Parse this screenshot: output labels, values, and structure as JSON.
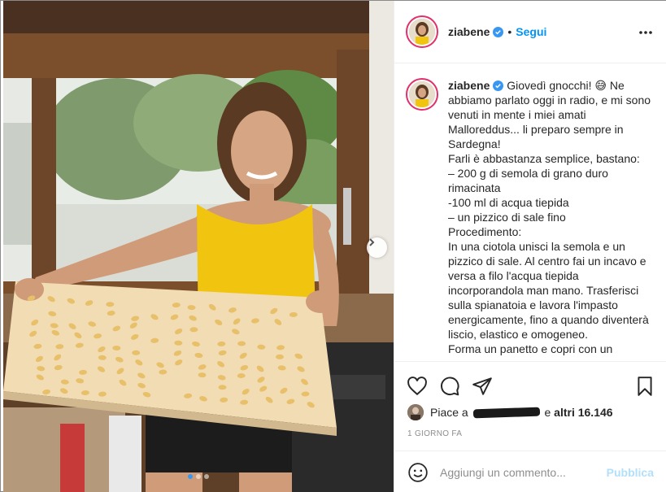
{
  "post": {
    "username": "ziabene",
    "follow_label": "Segui",
    "separator": "•",
    "caption_user": "ziabene",
    "caption_text": " Giovedì gnocchi! 😅 Ne abbiamo parlato oggi in radio, e mi sono venuti in mente i miei amati Malloreddus... li preparo sempre in Sardegna!\nFarli è abbastanza semplice, bastano:\n– 200 g di semola di grano duro rimacinata\n-100 ml di acqua tiepida\n– un pizzico di sale fino\nProcedimento:\nIn una ciotola unisci la semola e un pizzico di sale. Al centro fai un incavo e versa a filo l'acqua tiepida incorporandola man mano. Trasferisci sulla spianatoia e lavora l'impasto energicamente, fino a quando diventerà liscio, elastico e omogeneo.\nForma un panetto e copri con un",
    "likes_prefix": "Piace a",
    "likes_mid": "e",
    "likes_count": "altri 16.146",
    "timestamp": "1 GIORNO FA",
    "comment_placeholder": "Aggiungi un commento...",
    "publish_label": "Pubblica"
  },
  "icons": {
    "verified": "verified-badge-icon",
    "more": "more-options-icon",
    "like": "heart-icon",
    "comment": "comment-icon",
    "share": "paper-plane-icon",
    "save": "bookmark-icon",
    "emoji": "smiley-icon",
    "next": "chevron-right-icon"
  },
  "colors": {
    "accent": "#0095f6",
    "publish_disabled": "#b2dffc",
    "ring": "#e1306c"
  },
  "carousel": {
    "slides": 3,
    "active": 0
  }
}
